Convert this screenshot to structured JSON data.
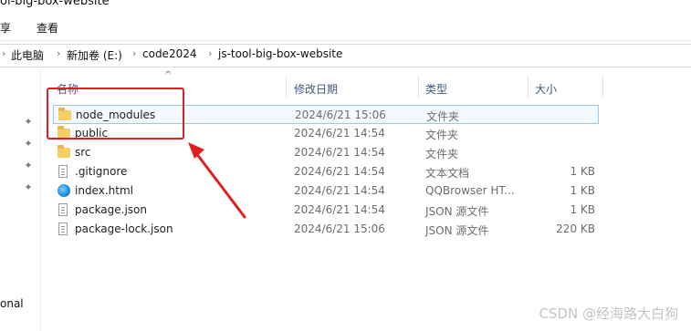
{
  "window": {
    "title_fragment": "ol-big-box-website"
  },
  "ribbon": {
    "tab_share": "享",
    "tab_view": "查看"
  },
  "address": {
    "crumbs": [
      "此电脑",
      "新加卷 (E:)",
      "code2024",
      "js-tool-big-box-website"
    ]
  },
  "columns": {
    "name": "名称",
    "date": "修改日期",
    "type": "类型",
    "size": "大小"
  },
  "files": [
    {
      "name": "node_modules",
      "date": "2024/6/21 15:06",
      "type": "文件夹",
      "size": "",
      "icon": "folder-icon"
    },
    {
      "name": "public",
      "date": "2024/6/21 14:54",
      "type": "文件夹",
      "size": "",
      "icon": "folder-icon"
    },
    {
      "name": "src",
      "date": "2024/6/21 14:54",
      "type": "文件夹",
      "size": "",
      "icon": "folder-icon"
    },
    {
      "name": ".gitignore",
      "date": "2024/6/21 14:54",
      "type": "文本文档",
      "size": "1 KB",
      "icon": "text-file-icon"
    },
    {
      "name": "index.html",
      "date": "2024/6/21 14:54",
      "type": "QQBrowser HT...",
      "size": "1 KB",
      "icon": "browser-icon"
    },
    {
      "name": "package.json",
      "date": "2024/6/21 14:54",
      "type": "JSON 源文件",
      "size": "1 KB",
      "icon": "json-file-icon"
    },
    {
      "name": "package-lock.json",
      "date": "2024/6/21 15:06",
      "type": "JSON 源文件",
      "size": "220 KB",
      "icon": "json-file-icon"
    }
  ],
  "nav": {
    "label_fragment": "onal"
  },
  "watermark": "CSDN @经海路大白狗",
  "colors": {
    "annotation": "#e02020",
    "selection_border": "#99c9ef",
    "folder": "#f5cf61"
  }
}
